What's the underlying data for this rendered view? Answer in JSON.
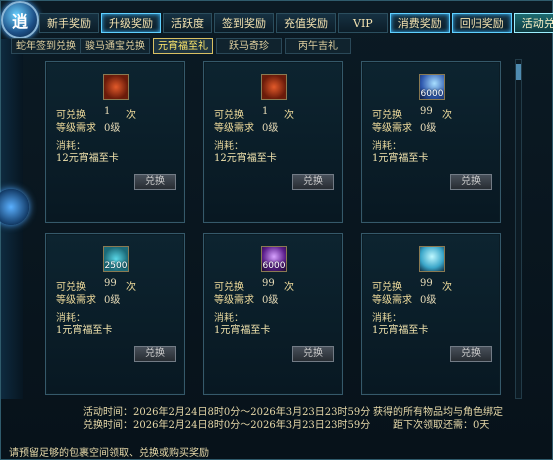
{
  "top_tabs": [
    "新手奖励",
    "升级奖励",
    "活跃度",
    "签到奖励",
    "充值奖励",
    "VIP",
    "消费奖励",
    "回归奖励",
    "活动兑换"
  ],
  "sub_tabs": [
    "蛇年签到兑换",
    "骏马通宝兑换",
    "元宵福至礼",
    "跃马奇珍",
    "丙午吉礼"
  ],
  "labels": {
    "exchangeable": "可兑换",
    "times": "次",
    "level_req": "等级需求",
    "consume": "消耗：",
    "btn": "兑换"
  },
  "cards": [
    {
      "qty": "1",
      "level": "0级",
      "cost": "12元宵福至卡",
      "icon": "red-pouch-icon",
      "num": ""
    },
    {
      "qty": "1",
      "level": "0级",
      "cost": "12元宵福至卡",
      "icon": "red-pouch-icon",
      "num": ""
    },
    {
      "qty": "99",
      "level": "0级",
      "cost": "1元宵福至卡",
      "icon": "blue-gem-icon",
      "num": "6000"
    },
    {
      "qty": "99",
      "level": "0级",
      "cost": "1元宵福至卡",
      "icon": "cyan-orb-icon",
      "num": "2500"
    },
    {
      "qty": "99",
      "level": "0级",
      "cost": "1元宵福至卡",
      "icon": "purple-orb-icon",
      "num": "6000"
    },
    {
      "qty": "99",
      "level": "0级",
      "cost": "1元宵福至卡",
      "icon": "aqua-crystal-icon",
      "num": ""
    }
  ],
  "footer": {
    "active_time": "活动时间：2026年2月24日8时0分～2026年3月23日23时59分",
    "exchange_time": "兑换时间：2026年2月24日8时0分～2026年3月23日23时59分",
    "note1": "获得的所有物品均与角色绑定",
    "note2": "距下次领取还需：0天",
    "bottom": "请预留足够的包裹空间领取、兑换或购买奖励"
  }
}
